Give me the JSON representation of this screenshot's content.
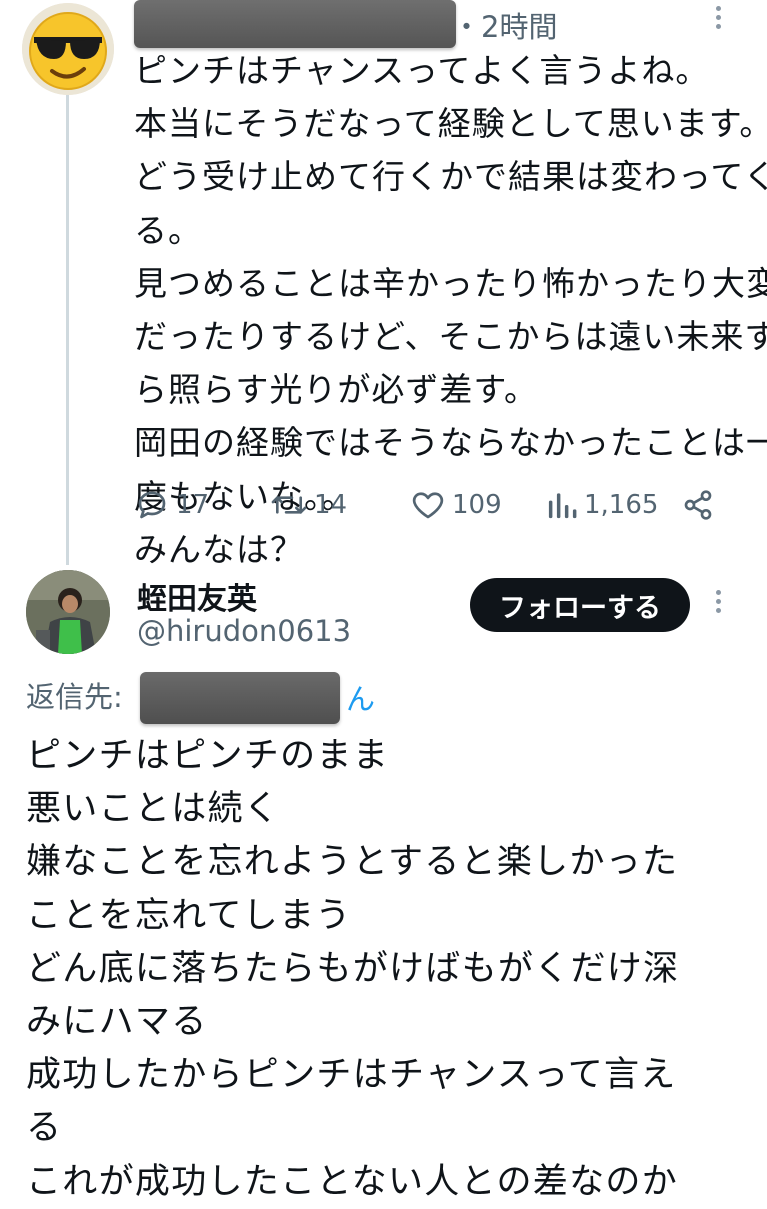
{
  "parent_tweet": {
    "time": "・2時間",
    "lines": [
      "ピンチはチャンスってよく言うよね。",
      "本当にそうだなって経験として思います。",
      "どう受け止めて行くかで結果は変わってく",
      "る。",
      "見つめることは辛かったり怖かったり大変",
      "だったりするけど、そこからは遠い未来す",
      "ら照らす光りが必ず差す。",
      "岡田の経験ではそうならなかったことは一",
      "度もないな。。",
      "みんなは？"
    ],
    "replies": "17",
    "retweets": "14",
    "likes": "109",
    "views": "1,165"
  },
  "reply_tweet": {
    "name": "蛭田友英",
    "handle": "@hirudon0613",
    "follow_label": "フォローする",
    "replying_to_prefix": "返信先:",
    "replying_to_suffix": "ん",
    "lines": [
      "ピンチはピンチのまま",
      "悪いことは続く",
      "嫌なことを忘れようとすると楽しかった",
      "ことを忘れてしまう",
      "どん底に落ちたらもがけばもがくだけ深",
      "みにハマる",
      "成功したからピンチはチャンスって言え",
      "る",
      "これが成功したことない人との差なのか"
    ]
  },
  "colors": {
    "text": "#0f1419",
    "muted": "#536471",
    "link": "#1d9bf0",
    "thread_line": "#cfd9de",
    "follow_bg": "#0f1419"
  },
  "icons": [
    "sunglasses-emoji-avatar",
    "more-vertical-icon",
    "reply-icon",
    "retweet-icon",
    "like-icon",
    "views-icon",
    "share-icon",
    "profile-photo-avatar"
  ]
}
